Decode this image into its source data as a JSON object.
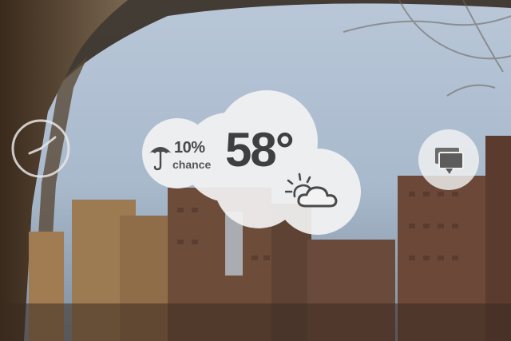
{
  "weather": {
    "precip_amount": "10%",
    "precip_label": "chance",
    "temperature": "58°",
    "condition_icon": "partly-cloudy-sun-icon",
    "precip_icon": "umbrella-icon"
  },
  "widgets": {
    "clock_icon": "clock-icon",
    "message_icon": "chat-bubbles-icon"
  },
  "colors": {
    "text": "#3f3f3f",
    "bubble": "#f2f2f2"
  }
}
